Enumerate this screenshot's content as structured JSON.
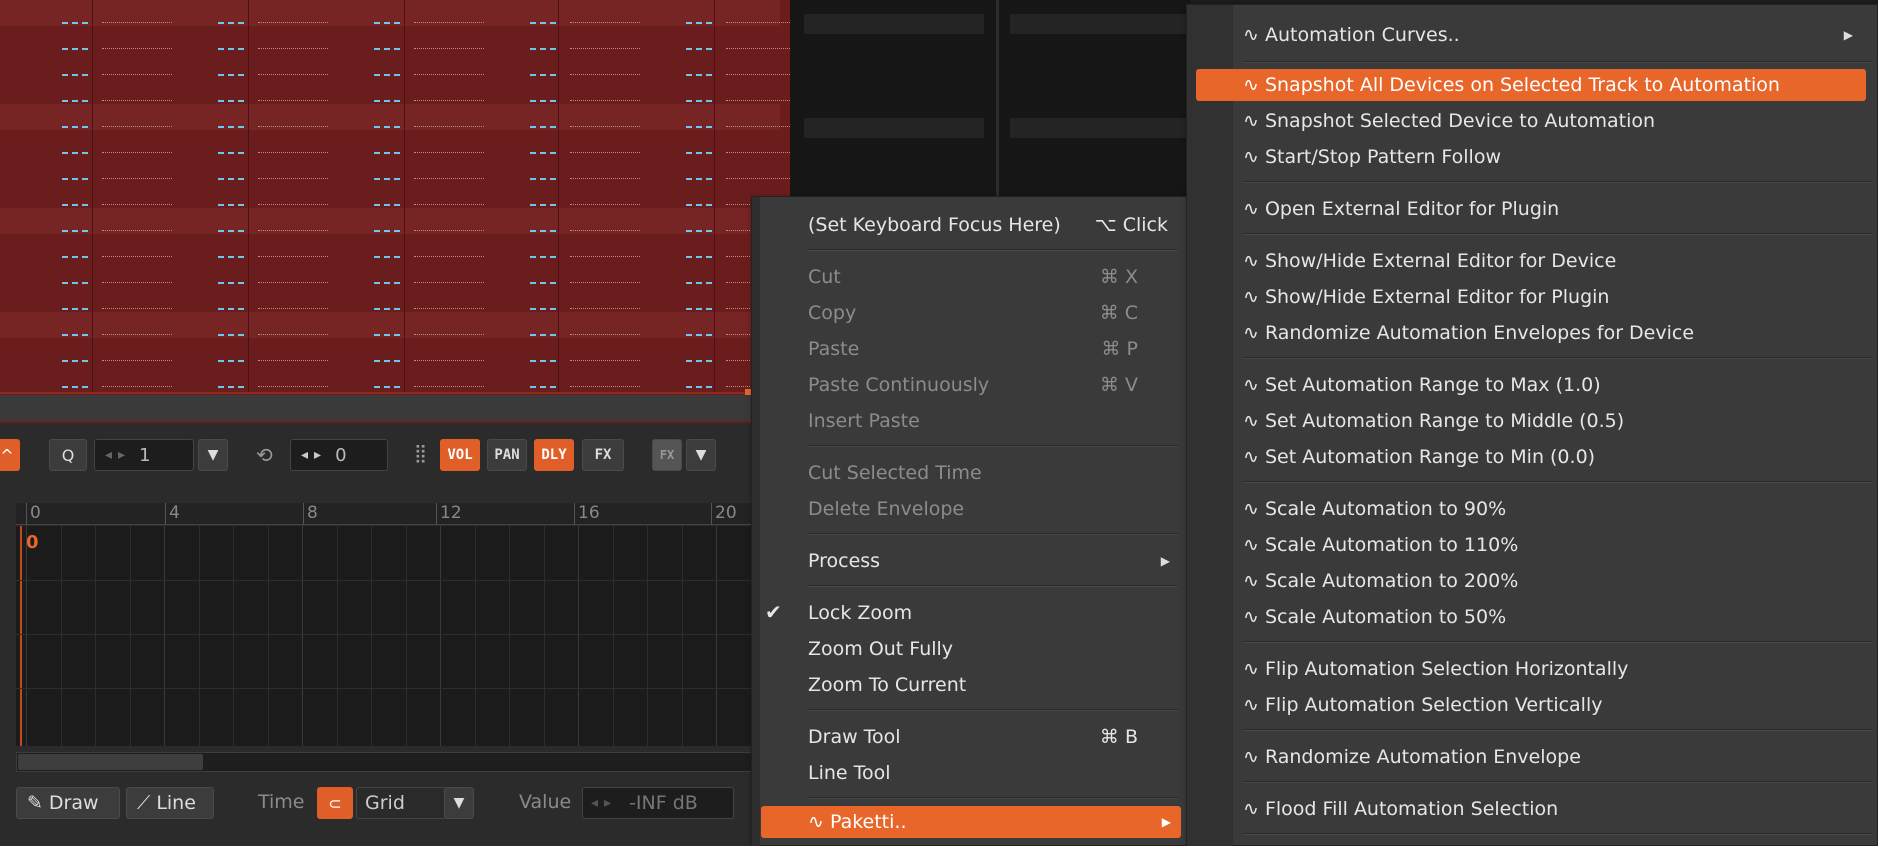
{
  "toolbar": {
    "quantize_icon": "Q",
    "line_value": "1",
    "shift_value": "0",
    "buttons": [
      "VOL",
      "PAN",
      "DLY",
      "FX"
    ],
    "fx_toggle": "FX"
  },
  "ruler": {
    "ticks": [
      "0",
      "4",
      "8",
      "12",
      "16",
      "20"
    ]
  },
  "envelope": {
    "cursor_value": "0"
  },
  "bottombar": {
    "draw_label": "Draw",
    "line_label": "Line",
    "time_label": "Time",
    "grid_value": "Grid",
    "value_label": "Value",
    "value_field": "-INF dB"
  },
  "context_menu": {
    "items": [
      {
        "label": "(Set Keyboard Focus Here)",
        "shortcut": "⌥ Click",
        "enabled": true
      },
      {
        "label": "Cut",
        "shortcut": "⌘ X",
        "enabled": false
      },
      {
        "label": "Copy",
        "shortcut": "⌘ C",
        "enabled": false
      },
      {
        "label": "Paste",
        "shortcut": "⌘ P",
        "enabled": false
      },
      {
        "label": "Paste Continuously",
        "shortcut": "⌘ V",
        "enabled": false
      },
      {
        "label": "Insert Paste",
        "shortcut": "",
        "enabled": false
      },
      {
        "label": "Cut Selected Time",
        "shortcut": "",
        "enabled": false
      },
      {
        "label": "Delete Envelope",
        "shortcut": "",
        "enabled": false
      },
      {
        "label": "Process",
        "shortcut": "",
        "enabled": true,
        "submenu": true
      },
      {
        "label": "Lock Zoom",
        "shortcut": "",
        "enabled": true,
        "checked": true
      },
      {
        "label": "Zoom Out Fully",
        "shortcut": "",
        "enabled": true
      },
      {
        "label": "Zoom To Current",
        "shortcut": "",
        "enabled": true
      },
      {
        "label": "Draw Tool",
        "shortcut": "⌘ B",
        "enabled": true
      },
      {
        "label": "Line Tool",
        "shortcut": "",
        "enabled": true
      },
      {
        "label": "∿ Paketti..",
        "shortcut": "",
        "enabled": true,
        "submenu": true,
        "highlighted": true
      }
    ]
  },
  "paketti_menu": {
    "items": [
      {
        "label": "∿ Automation Curves..",
        "submenu": true
      },
      {
        "label": "∿ Snapshot All Devices on Selected Track to Automation",
        "highlighted": true
      },
      {
        "label": "∿ Snapshot Selected Device to Automation"
      },
      {
        "label": "∿ Start/Stop Pattern Follow"
      },
      {
        "label": "∿ Open External Editor for Plugin"
      },
      {
        "label": "∿ Show/Hide External Editor for Device"
      },
      {
        "label": "∿ Show/Hide External Editor for Plugin"
      },
      {
        "label": "∿ Randomize Automation Envelopes for Device"
      },
      {
        "label": "∿ Set Automation Range to Max (1.0)"
      },
      {
        "label": "∿ Set Automation Range to Middle (0.5)"
      },
      {
        "label": "∿ Set Automation Range to Min (0.0)"
      },
      {
        "label": "∿ Scale Automation to 90%"
      },
      {
        "label": "∿ Scale Automation to 110%"
      },
      {
        "label": "∿ Scale Automation to 200%"
      },
      {
        "label": "∿ Scale Automation to 50%"
      },
      {
        "label": "∿ Flip Automation Selection Horizontally"
      },
      {
        "label": "∿ Flip Automation Selection Vertically"
      },
      {
        "label": "∿ Randomize Automation Envelope"
      },
      {
        "label": "∿ Flood Fill Automation Selection"
      }
    ]
  },
  "colors": {
    "accent": "#e8662a",
    "pattern_bg": "#6b1d1e",
    "menu_bg": "#3a3a3a"
  }
}
